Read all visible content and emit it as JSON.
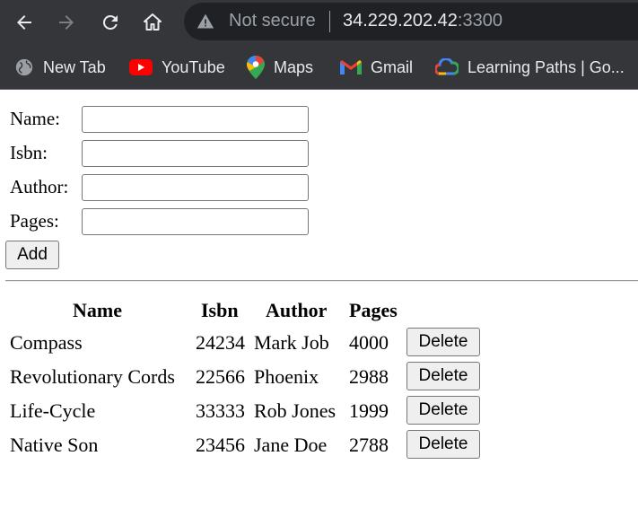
{
  "browser": {
    "address": {
      "security_text": "Not secure",
      "host": "34.229.202.42",
      "port": ":3300"
    },
    "icons": {
      "back": "arrow-left-icon",
      "forward": "arrow-right-icon",
      "reload": "reload-icon",
      "home": "home-icon",
      "warning": "warning-triangle-icon"
    },
    "bookmarks": [
      {
        "label": "New Tab",
        "icon": "globe-icon"
      },
      {
        "label": "YouTube",
        "icon": "youtube-icon"
      },
      {
        "label": "Maps",
        "icon": "maps-pin-icon"
      },
      {
        "label": "Gmail",
        "icon": "gmail-icon"
      },
      {
        "label": "Learning Paths | Go...",
        "icon": "google-cloud-icon"
      }
    ],
    "colors": {
      "chrome_bg": "#35363a",
      "omnibox_bg": "#202124"
    }
  },
  "form": {
    "fields": [
      {
        "label": "Name:",
        "value": ""
      },
      {
        "label": "Isbn:",
        "value": ""
      },
      {
        "label": "Author:",
        "value": ""
      },
      {
        "label": "Pages:",
        "value": ""
      }
    ],
    "add_label": "Add"
  },
  "table": {
    "headers": [
      "Name",
      "Isbn",
      "Author",
      "Pages"
    ],
    "rows": [
      {
        "name": "Compass",
        "isbn": "24234",
        "author": "Mark Job",
        "pages": "4000",
        "action": "Delete"
      },
      {
        "name": "Revolutionary Cords",
        "isbn": "22566",
        "author": "Phoenix",
        "pages": "2988",
        "action": "Delete"
      },
      {
        "name": "Life-Cycle",
        "isbn": "33333",
        "author": "Rob Jones",
        "pages": "1999",
        "action": "Delete"
      },
      {
        "name": "Native Son",
        "isbn": "23456",
        "author": "Jane Doe",
        "pages": "2788",
        "action": "Delete"
      }
    ]
  }
}
